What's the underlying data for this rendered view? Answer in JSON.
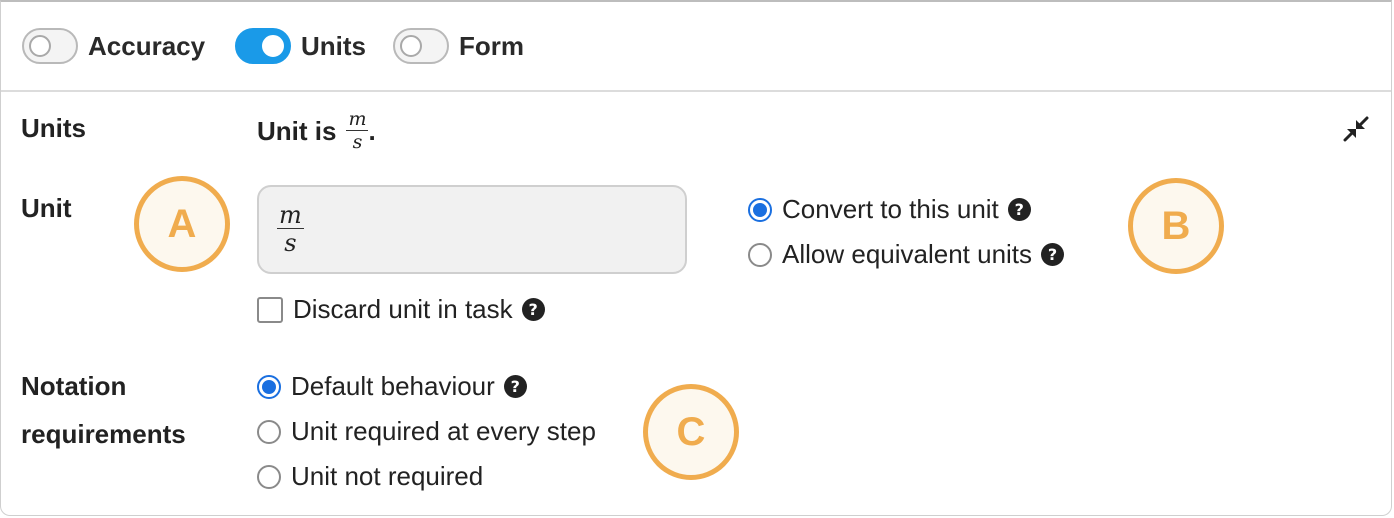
{
  "toggles": [
    {
      "label": "Accuracy",
      "on": false
    },
    {
      "label": "Units",
      "on": true
    },
    {
      "label": "Form",
      "on": false
    }
  ],
  "units_section": {
    "title": "Units",
    "summary_prefix": "Unit is",
    "summary_unit": {
      "numerator": "m",
      "denominator": "s"
    },
    "summary_suffix": "."
  },
  "unit_field": {
    "label": "Unit",
    "value": {
      "numerator": "m",
      "denominator": "s"
    }
  },
  "unit_mode": {
    "options": [
      "Convert to this unit",
      "Allow equivalent units"
    ],
    "selected": "Convert to this unit"
  },
  "discard_unit": {
    "label": "Discard unit in task",
    "checked": false
  },
  "notation": {
    "label_line1": "Notation",
    "label_line2": "requirements",
    "options": [
      "Default behaviour",
      "Unit required at every step",
      "Unit not required"
    ],
    "selected": "Default behaviour"
  },
  "help_glyph": "?",
  "badges": [
    "A",
    "B",
    "C"
  ],
  "icons": {
    "collapse": "collapse-arrows-icon",
    "help": "question-circle-icon"
  },
  "colors": {
    "toggle_on": "#1a9ae8",
    "radio_selected": "#1a6fe0",
    "badge": "#f0ac4e"
  }
}
